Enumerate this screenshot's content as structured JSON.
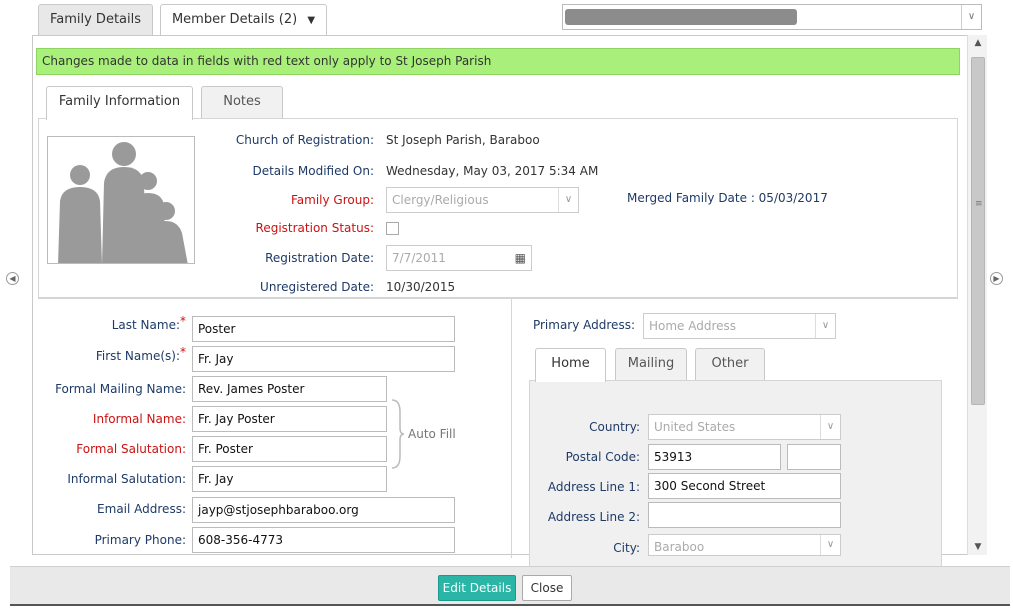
{
  "top_tabs": [
    {
      "label": "Family Details",
      "active": true
    },
    {
      "label": "Member Details (2)",
      "active": false
    }
  ],
  "top_tabs_dropdown_icon": "caret-down-icon",
  "notice": "Changes made to data in fields with red text only apply to St Joseph Parish",
  "sub_tabs": [
    "Family Information",
    "Notes"
  ],
  "family": {
    "church_label": "Church of Registration:",
    "church_value": "St Joseph Parish, Baraboo",
    "modified_label": "Details Modified On:",
    "modified_value": "Wednesday, May 03, 2017 5:34 AM",
    "group_label": "Family Group:",
    "group_value": "Clergy/Religious",
    "merged_label": "Merged Family Date : 05/03/2017",
    "status_label": "Registration Status:",
    "reg_date_label": "Registration Date:",
    "reg_date_value": "7/7/2011",
    "unreg_label": "Unregistered Date:",
    "unreg_value": "10/30/2015"
  },
  "member": {
    "last_name_label": "Last Name:",
    "last_name_value": "Poster",
    "first_name_label": "First Name(s):",
    "first_name_value": "Fr. Jay",
    "required_mark": "*",
    "formal_mailing_label": "Formal Mailing Name:",
    "formal_mailing_value": "Rev.  James  Poster",
    "informal_name_label": "Informal Name:",
    "informal_name_value": "Fr. Jay Poster",
    "formal_salutation_label": "Formal Salutation:",
    "formal_salutation_value": "Fr. Poster",
    "informal_salutation_label": "Informal Salutation:",
    "informal_salutation_value": "Fr. Jay",
    "auto_fill": "Auto Fill",
    "email_label": "Email Address:",
    "email_value": "jayp@stjosephbaraboo.org",
    "phone_label": "Primary Phone:",
    "phone_value": "608-356-4773"
  },
  "address": {
    "primary_label": "Primary Address:",
    "primary_value": "Home Address",
    "tabs": [
      "Home",
      "Mailing",
      "Other"
    ],
    "country_label": "Country:",
    "country_value": "United States",
    "postal_label": "Postal Code:",
    "postal_value": "53913",
    "line1_label": "Address Line 1:",
    "line1_value": "300 Second Street",
    "line2_label": "Address Line 2:",
    "line2_value": "",
    "city_label": "City:",
    "city_value": "Baraboo"
  },
  "buttons": {
    "edit": "Edit Details",
    "close": "Close"
  },
  "colors": {
    "notice_bg": "#a8f07a",
    "required_red": "#cc1111",
    "label_blue": "#1e3a66",
    "primary_button": "#2ab5a7"
  }
}
